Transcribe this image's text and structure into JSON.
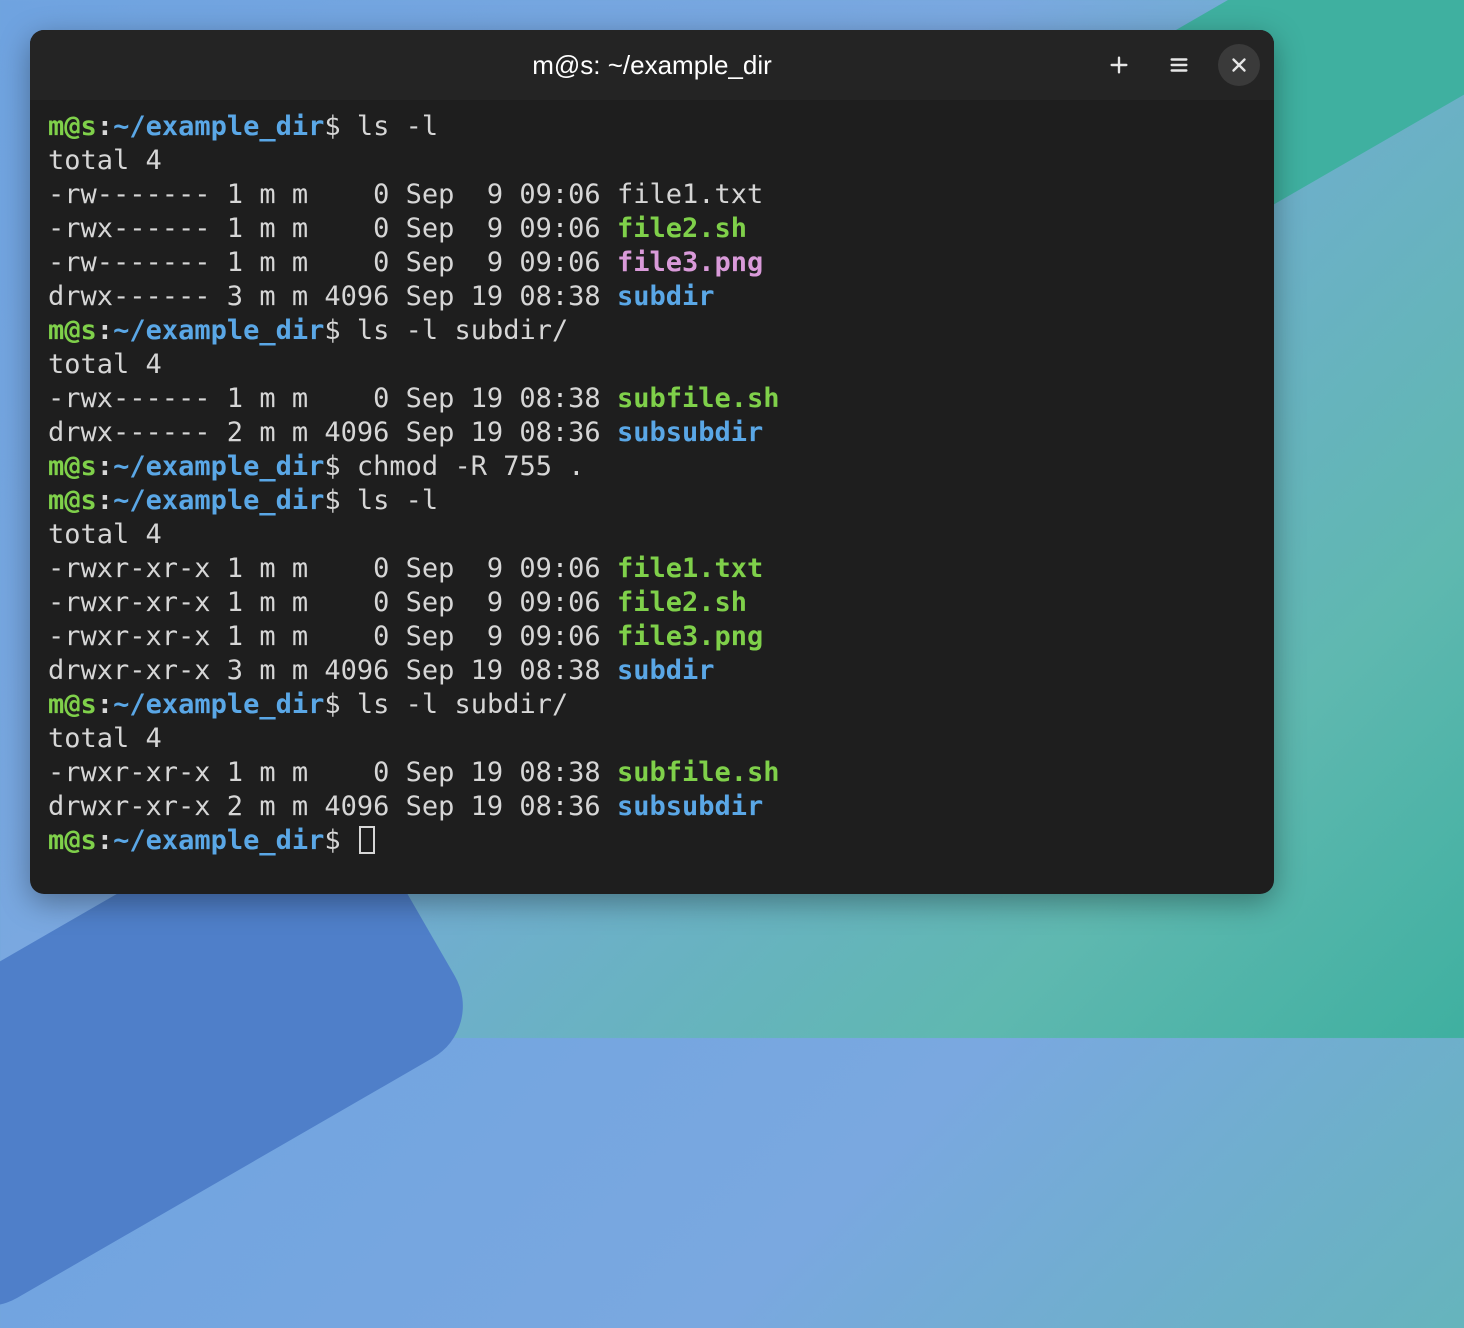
{
  "window": {
    "title": "m@s: ~/example_dir"
  },
  "prompt": {
    "user": "m",
    "at": "@",
    "host": "s",
    "colon": ":",
    "path": "~/example_dir",
    "dollar": "$ "
  },
  "blocks": [
    {
      "cmd": "ls -l",
      "out": [
        [
          [
            "",
            "total 4"
          ]
        ],
        [
          [
            "",
            "-rw------- 1 m m    0 Sep  9 09:06 file1.txt"
          ]
        ],
        [
          [
            "",
            "-rwx------ 1 m m    0 Sep  9 09:06 "
          ],
          [
            "exec",
            "file2.sh"
          ]
        ],
        [
          [
            "",
            "-rw------- 1 m m    0 Sep  9 09:06 "
          ],
          [
            "png",
            "file3.png"
          ]
        ],
        [
          [
            "",
            "drwx------ 3 m m 4096 Sep 19 08:38 "
          ],
          [
            "dir",
            "subdir"
          ]
        ]
      ]
    },
    {
      "cmd": "ls -l subdir/",
      "out": [
        [
          [
            "",
            "total 4"
          ]
        ],
        [
          [
            "",
            "-rwx------ 1 m m    0 Sep 19 08:38 "
          ],
          [
            "exec",
            "subfile.sh"
          ]
        ],
        [
          [
            "",
            "drwx------ 2 m m 4096 Sep 19 08:36 "
          ],
          [
            "dir",
            "subsubdir"
          ]
        ]
      ]
    },
    {
      "cmd": "chmod -R 755 .",
      "out": []
    },
    {
      "cmd": "ls -l",
      "out": [
        [
          [
            "",
            "total 4"
          ]
        ],
        [
          [
            "",
            "-rwxr-xr-x 1 m m    0 Sep  9 09:06 "
          ],
          [
            "exec",
            "file1.txt"
          ]
        ],
        [
          [
            "",
            "-rwxr-xr-x 1 m m    0 Sep  9 09:06 "
          ],
          [
            "exec",
            "file2.sh"
          ]
        ],
        [
          [
            "",
            "-rwxr-xr-x 1 m m    0 Sep  9 09:06 "
          ],
          [
            "exec",
            "file3.png"
          ]
        ],
        [
          [
            "",
            "drwxr-xr-x 3 m m 4096 Sep 19 08:38 "
          ],
          [
            "dir",
            "subdir"
          ]
        ]
      ]
    },
    {
      "cmd": "ls -l subdir/",
      "out": [
        [
          [
            "",
            "total 4"
          ]
        ],
        [
          [
            "",
            "-rwxr-xr-x 1 m m    0 Sep 19 08:38 "
          ],
          [
            "exec",
            "subfile.sh"
          ]
        ],
        [
          [
            "",
            "drwxr-xr-x 2 m m 4096 Sep 19 08:36 "
          ],
          [
            "dir",
            "subsubdir"
          ]
        ]
      ]
    }
  ],
  "trailing_prompt": true
}
